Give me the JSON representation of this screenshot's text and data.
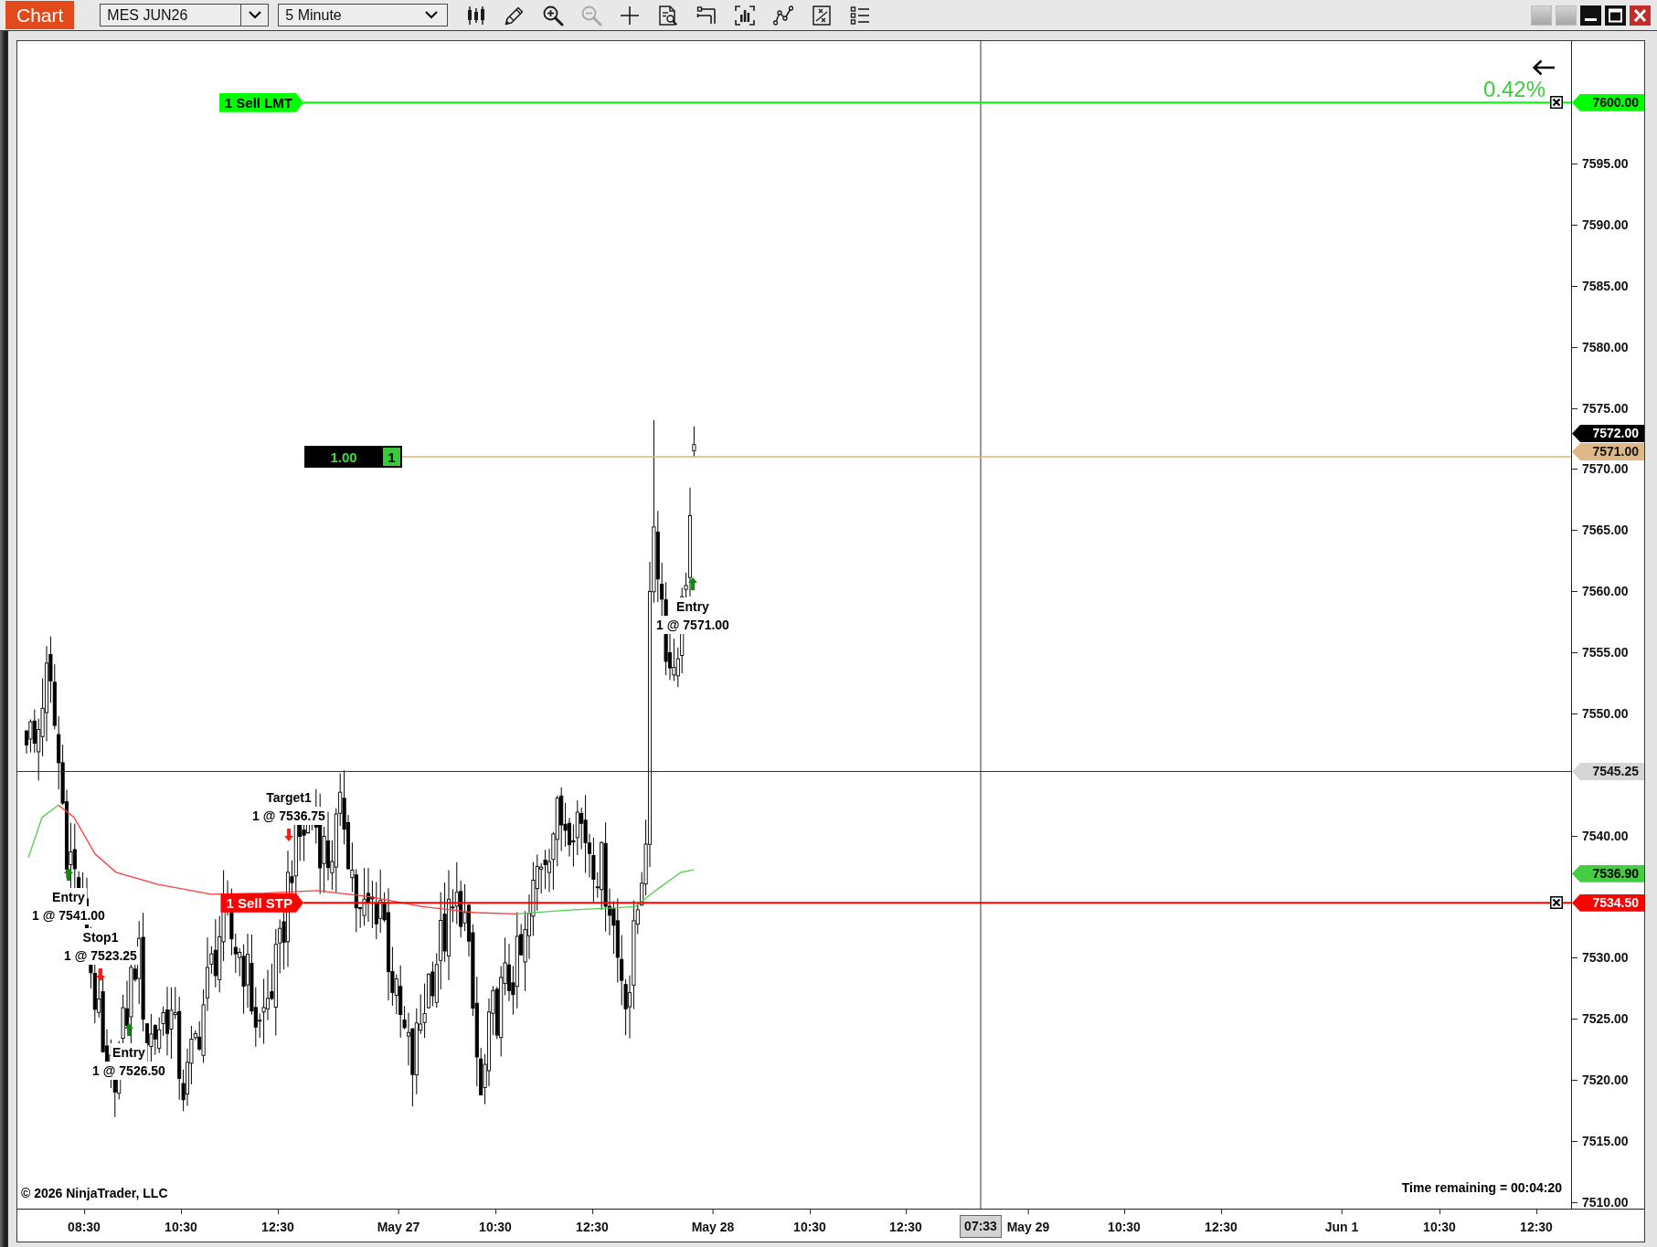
{
  "toolbar": {
    "tab": "Chart",
    "instrument": "MES JUN26",
    "interval": "5 Minute",
    "tools": [
      {
        "kind": "chart_style",
        "disabled": false
      },
      {
        "kind": "drawing_tools",
        "disabled": false
      },
      {
        "kind": "zoom_in",
        "disabled": false
      },
      {
        "kind": "zoom_out",
        "disabled": true
      },
      {
        "kind": "crosshair",
        "disabled": false
      },
      {
        "kind": "data_box",
        "disabled": false
      },
      {
        "kind": "templates",
        "disabled": false
      },
      {
        "kind": "scale",
        "disabled": false
      },
      {
        "kind": "strategies",
        "disabled": false
      },
      {
        "kind": "properties",
        "disabled": false
      },
      {
        "kind": "indicators",
        "disabled": false
      }
    ],
    "window_controls": [
      {
        "kind": "blank"
      },
      {
        "kind": "blank"
      },
      {
        "kind": "minimize"
      },
      {
        "kind": "maximize"
      },
      {
        "kind": "close"
      }
    ]
  },
  "chart": {
    "pnl": "0.42%",
    "orders": [
      {
        "kind": "limit",
        "label": "1 Sell LMT",
        "price": "7600.00",
        "color": "#00ff00"
      },
      {
        "kind": "stop",
        "label": "1 Sell STP",
        "price": "7534.50",
        "color": "#ff0000"
      }
    ],
    "position": {
      "quantity": "1.00",
      "contracts": "1",
      "price": "7571.00"
    },
    "last_price": "7572.00",
    "indicator_value": "7536.90",
    "crosshair": {
      "price": "7545.25",
      "time": "07:33"
    },
    "executions": [
      {
        "kind": "buy",
        "label": "Entry",
        "fill": "1 @ 7541.00"
      },
      {
        "kind": "sell",
        "label": "Stop1",
        "fill": "1 @ 7523.25"
      },
      {
        "kind": "buy",
        "label": "Entry",
        "fill": "1 @ 7526.50"
      },
      {
        "kind": "sell",
        "label": "Target1",
        "fill": "1 @ 7536.75"
      },
      {
        "kind": "buy",
        "label": "Entry",
        "fill": "1 @ 7571.00"
      }
    ],
    "price_axis": [
      "7595.00",
      "7590.00",
      "7585.00",
      "7580.00",
      "7575.00",
      "7570.00",
      "7565.00",
      "7560.00",
      "7555.00",
      "7550.00",
      "7540.00",
      "7530.00",
      "7525.00",
      "7520.00",
      "7515.00",
      "7510.00"
    ],
    "time_axis": [
      "08:30",
      "10:30",
      "12:30",
      "May 27",
      "10:30",
      "12:30",
      "May 28",
      "10:30",
      "12:30",
      "May 29",
      "10:30",
      "12:30",
      "Jun 1",
      "10:30",
      "12:30"
    ],
    "copyright": "© 2026 NinjaTrader, LLC",
    "time_remaining": "Time remaining = 00:04:20"
  }
}
